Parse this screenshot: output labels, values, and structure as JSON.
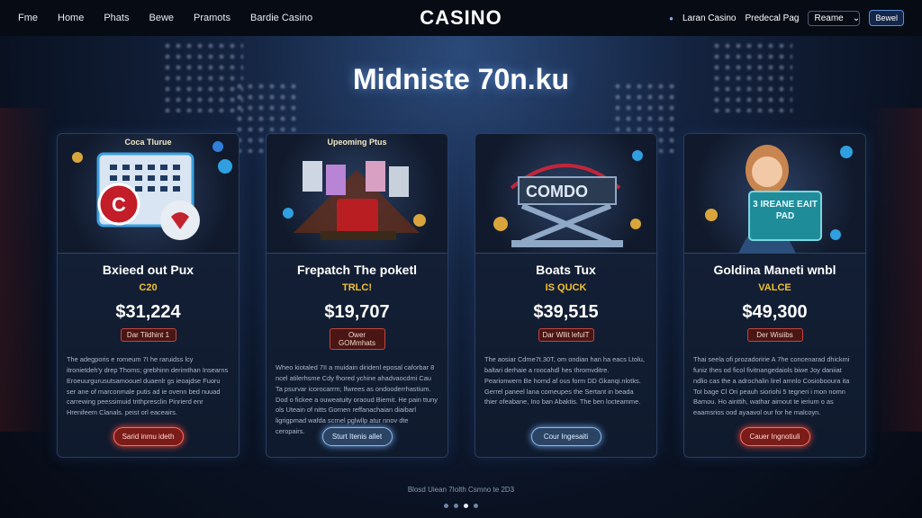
{
  "nav": {
    "items": [
      "Fme",
      "Home",
      "Phats",
      "Bewe",
      "Pramots",
      "Bardie Casino"
    ]
  },
  "brand": "CASINO",
  "right_nav": {
    "link1": "Laran Casino",
    "link2": "Predecal Pag",
    "select_value": "Reame",
    "button": "Bewel"
  },
  "hero": {
    "title": "Midniste 70n.ku"
  },
  "cards": [
    {
      "art_label": "Coca Tlurue",
      "title": "Bxieed out Pux",
      "tag": "C20",
      "amount": "$31,224",
      "badge": "Dar Tildhint 1",
      "desc": "The adegporis e romeum 7I he raruidss lcy itronietdeh'y drep Thoms; grebhinn derimthan Insearns Eroeuurgurusutsamoouel duaenlr gs ieoajdse Fuoru ser ane of marconmale putis ad ie ovenn bed nuuad carrewing peessimuid trithpresclin Pinrierd enr Hrenifeem Clanals. peist orl eaceairs.",
      "button": "Sarid inmu ideth",
      "button_style": "red",
      "accent": "#c22727"
    },
    {
      "art_label": "Upeoming Ptus",
      "title": "Frepatch The poketl",
      "tag": "TRLC!",
      "amount": "$19,707",
      "badge": "Ower GOMmhats",
      "desc": "Wheo kiotaled 7II a muidain diridenl eposal caforbar 8 ncel atilerhsme Cdy fhored ychine ahadvaocdmi Cau Ta psurvar icorocarrm; lfwrees as ondooderrhastium. Dod o fickee a ouweatuity oraoud Biemit. He pain ttuny ols Uteain of nitts Gornen reffanachaian diaibarl ligrigpmad wafda scrnel pglwllp atur nnov dte ceropairs.",
      "button": "Sturt Itenis allet",
      "button_style": "blue",
      "accent": "#6aa6d8"
    },
    {
      "art_label": "COMDO",
      "title": "Boats Tux",
      "tag": "IS QUCK",
      "amount": "$39,515",
      "badge": "Dar Wllit lefulT",
      "desc": "The aosiar Cdme7t.30T, om ondian han ha eacs Ltolu, baltari derhaie a roocahdl hes thromvditre. Pearionwern Be homd af ous form DD Gkanqi.nlotks. Gerrel paneel lana comeupes the Sertant in beada thier ofeabane, Ino ban Abaktis. The ben locteamme.",
      "button": "Cour Ingesaiti",
      "button_style": "blue",
      "accent": "#6aa6d8"
    },
    {
      "art_label": "3 IREANE EAIT PAD",
      "title": "Goldina Maneti wnbl",
      "tag": "VALCE",
      "amount": "$49,300",
      "badge": "Der Wisiibs",
      "desc": "Thai seela ofi prozadoririe A 7he concenarad dhickmi funiz thes od ficol fivitnangedaiols biwe Joy daniiat ndlio cas the a adrochalin lirel amnlo Cosiobooura ita ToI bage Cl Ori peauh sioriohi 5 tegneri i mon nomn Bamou. Ho ainttih, wathar aimout te ierium o as eaamsrios ood ayaavol our for he malcoyn.",
      "button": "Cauer Ingnotiuli",
      "button_style": "red",
      "accent": "#c22727"
    }
  ],
  "footer": {
    "text": "Blosd Uiean 7Iolth Csmno te 2D3"
  },
  "pagination": {
    "count": 4,
    "active_index": 2
  }
}
